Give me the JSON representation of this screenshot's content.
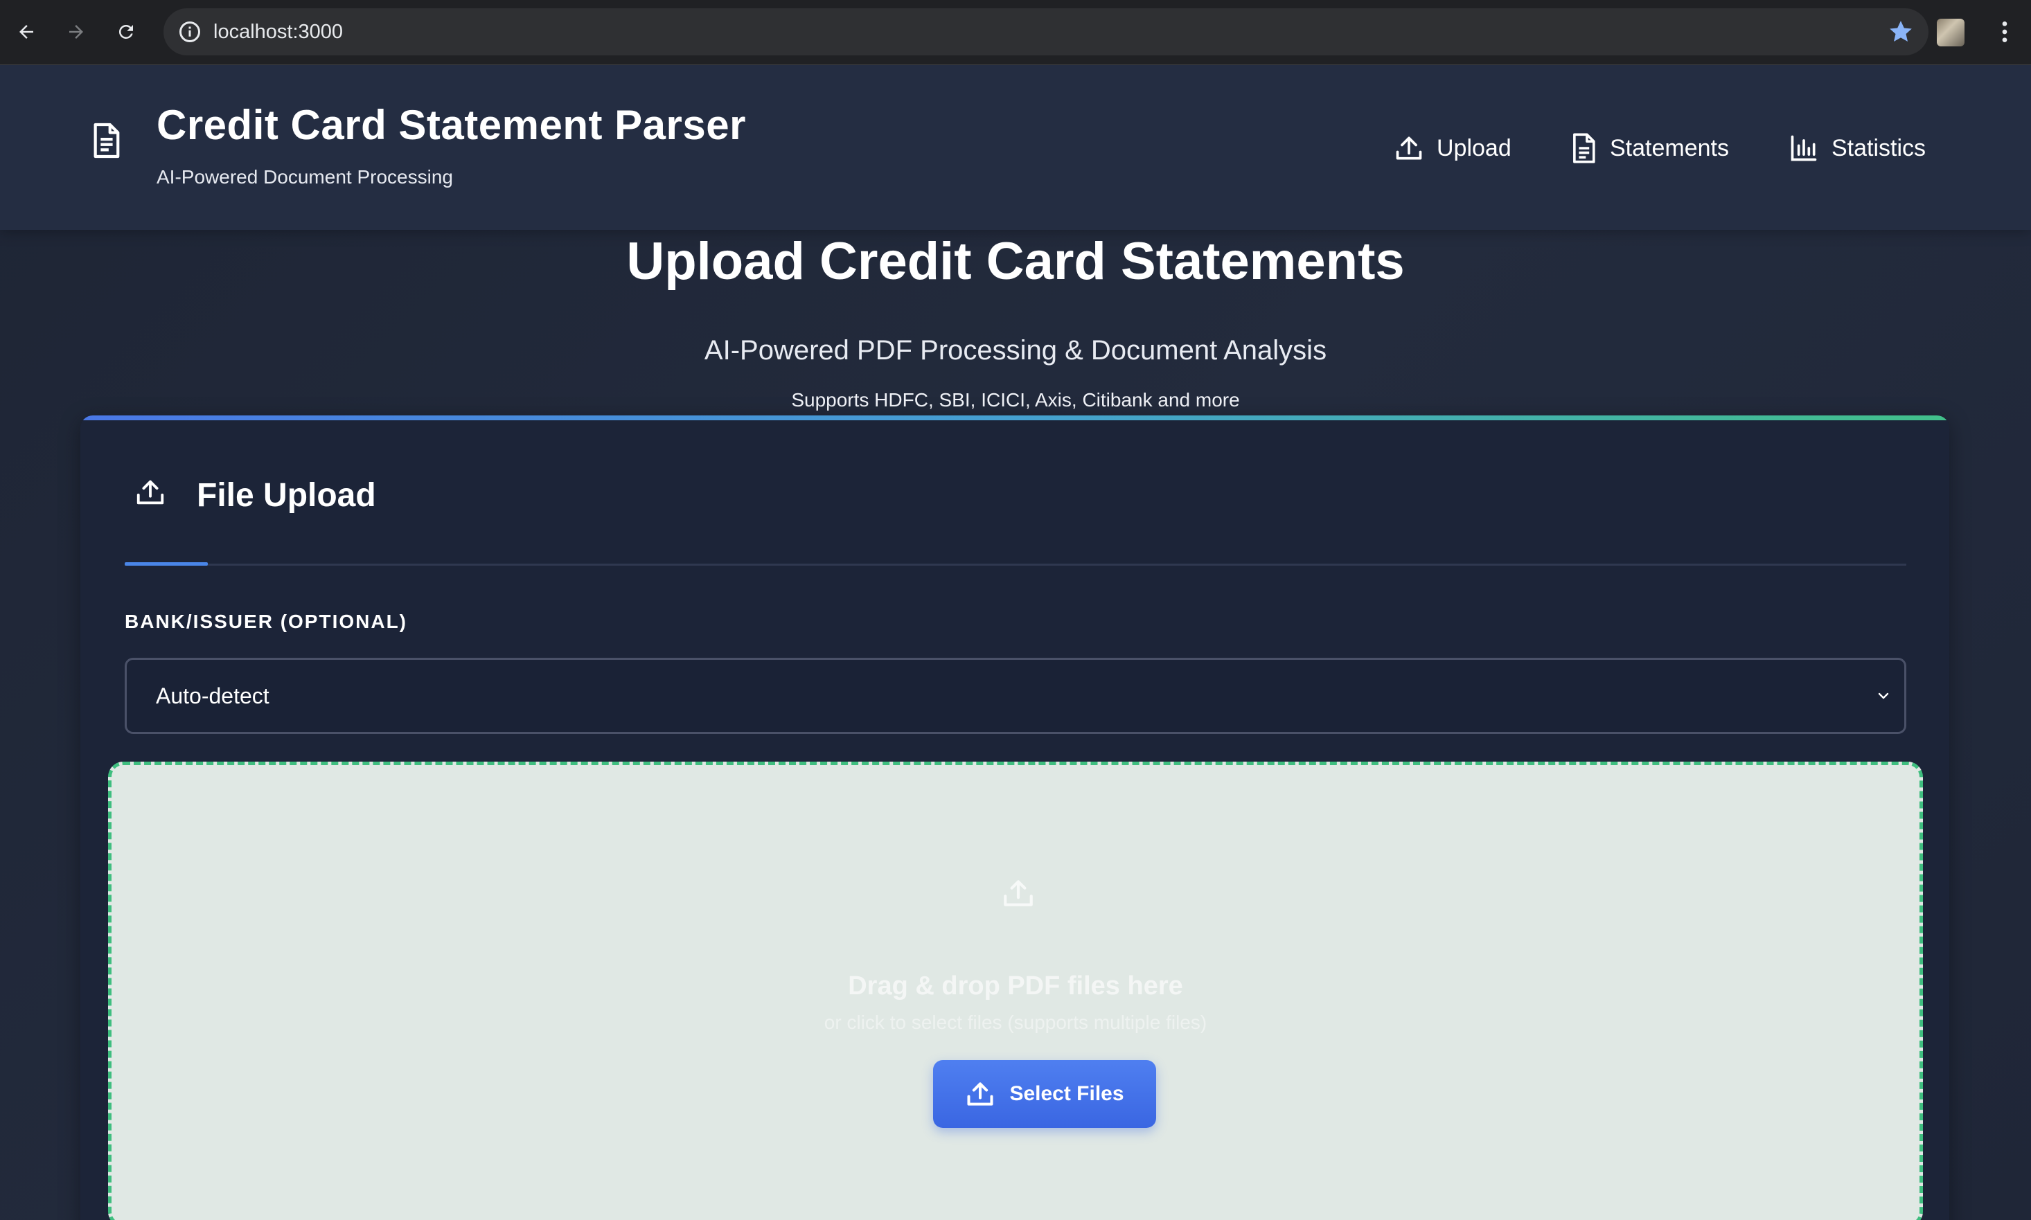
{
  "browser": {
    "url": "localhost:3000",
    "accent_color": "#8ab4f8"
  },
  "header": {
    "title": "Credit Card Statement Parser",
    "subtitle": "AI-Powered Document Processing",
    "nav": [
      {
        "label": "Upload",
        "icon": "upload-icon"
      },
      {
        "label": "Statements",
        "icon": "document-icon"
      },
      {
        "label": "Statistics",
        "icon": "bar-chart-icon"
      }
    ]
  },
  "hero": {
    "title": "Upload Credit Card Statements",
    "subtitle": "AI-Powered PDF Processing & Document Analysis",
    "support": "Supports HDFC, SBI, ICICI, Axis, Citibank and more"
  },
  "upload_card": {
    "title": "File Upload",
    "bank_label": "BANK/ISSUER (OPTIONAL)",
    "bank_selected": "Auto-detect",
    "dropzone_title": "Drag & drop PDF files here",
    "dropzone_hint": "or click to select files (supports multiple files)",
    "select_button": "Select Files",
    "colors": {
      "dropzone_border": "#3fbe7f",
      "button": "#4a78e6"
    }
  }
}
